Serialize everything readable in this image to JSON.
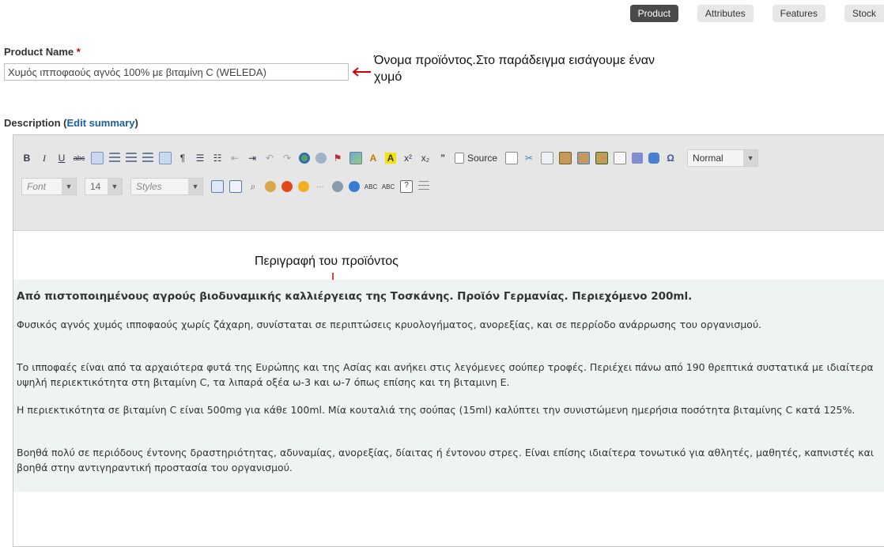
{
  "tabs": [
    "Product",
    "Attributes",
    "Features",
    "Stock"
  ],
  "active_tab": "Product",
  "product_name": {
    "label": "Product Name",
    "required_mark": "*",
    "value": "Χυμός ιπποφαούς αγνός 100% με βιταμίνη C (WELEDA)"
  },
  "annotation_name": "Όνομα προϊόντος.Στο παράδειγμα εισάγουμε έναν χυμό",
  "description": {
    "label": "Description",
    "edit_link": "Edit summary"
  },
  "editor": {
    "source_label": "Source",
    "format_value": "Normal",
    "font_placeholder": "Font",
    "size_value": "14",
    "styles_placeholder": "Styles"
  },
  "annotation_desc": "Περιγραφή του προϊόντος",
  "content": {
    "lead": "Από πιστοποιημένους αγρούς βιοδυναμικής καλλιέργειας της Τοσκάνης. Προϊόν Γερμανίας. Περιεχόμενο 200ml.",
    "paragraphs": [
      "Φυσικός αγνός χυμός ιπποφαούς χωρίς ζάχαρη, συνίσταται σε περιπτώσεις κρυολογήματος, ανορεξίας, και σε περρίοδο ανάρρωσης του οργανισμού.",
      "Το ιπποφαές είναι από τα αρχαιότερα φυτά της Ευρώπης και της Ασίας και ανήκει στις λεγόμενες σούπερ τροφές. Περιέχει πάνω από 190 θρεπτικά συστατικά με ιδιαίτερα υψηλή περιεκτικότητα στη βιταμίνη C, τα λιπαρά οξέα ω-3 και ω-7 όπως επίσης και τη βιταμινη Ε.",
      "Η περιεκτικότητα σε βιταμίνη C είναι 500mg για κάθε 100ml. Μία κουταλιά της σούπας (15ml) καλύπτει την συνιστώμενη ημερήσια ποσότητα βιταμίνης C κατά 125%.",
      "Βοηθά πολύ σε περιόδους έντονης δραστηριότητας, αδυναμίας, ανορεξίας, δίαιτας ή έντονου στρες. Είναι επίσης ιδιαίτερα τονωτικό για αθλητές, μαθητές, καπνιστές και βοηθά στην αντιγηραντική προστασία του οργανισμού."
    ]
  },
  "colors": {
    "active_tab_bg": "#4a4a4a",
    "tab_bg": "#e7e7e7",
    "link": "#1a5fa0",
    "required": "#cc0000",
    "annotation_arrow": "#d40000",
    "content_bg": "#eef4f4",
    "toolbar_bg": "#e6e6e6"
  }
}
